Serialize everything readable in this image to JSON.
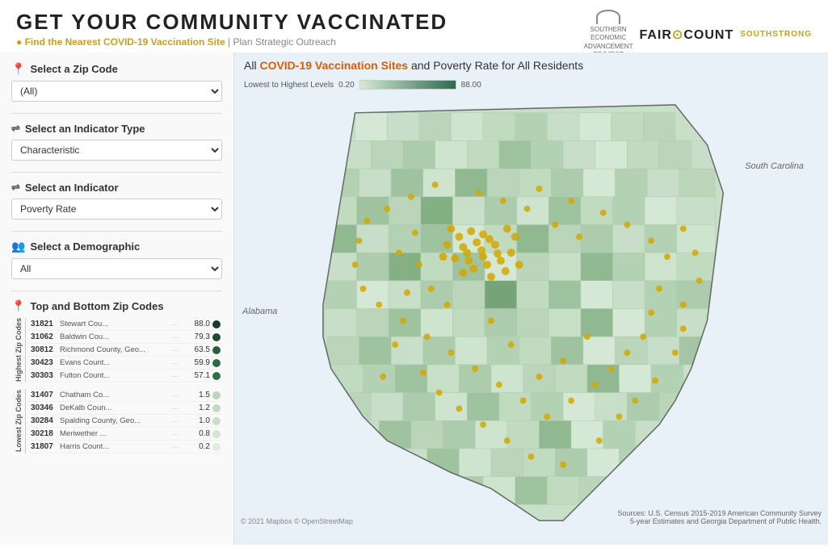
{
  "page": {
    "title": "GET YOUR COMMUNITY VACCINATED",
    "subtitle_link": "Find the Nearest COVID-19 Vaccination Site",
    "subtitle_separator": " | ",
    "subtitle_text": "Plan Strategic Outreach"
  },
  "logos": {
    "seap": "SOUTHERN\nECONOMIC\nADVANCEMENT\nPROJECT",
    "faircount": "FAIR COUNT",
    "southstrong": "SOUTHSTRONG"
  },
  "sidebar": {
    "zip_section": {
      "title": "Select a Zip Code",
      "icon": "location",
      "options": [
        "(All)"
      ],
      "selected": "(All)"
    },
    "indicator_type_section": {
      "title": "Select an Indicator Type",
      "icon": "filter",
      "options": [
        "Characteristic"
      ],
      "selected": "Characteristic"
    },
    "indicator_section": {
      "title": "Select an Indicator",
      "icon": "filter",
      "options": [
        "Poverty Rate"
      ],
      "selected": "Poverty Rate"
    },
    "demographic_section": {
      "title": "Select a Demographic",
      "icon": "people",
      "options": [
        "All"
      ],
      "selected": "All"
    },
    "top_bottom_title": "Top and Bottom Zip Codes",
    "highest_label": "Highest Zip Codes",
    "lowest_label": "Lowest Zip Codes",
    "highest_zips": [
      {
        "code": "31821",
        "county": "Stewart Cou...",
        "value": "88.0",
        "color": "#1a3a2a"
      },
      {
        "code": "31062",
        "county": "Baldwin Cou...",
        "value": "79.3",
        "color": "#1e4a30"
      },
      {
        "code": "30812",
        "county": "Richmond County, Geo...",
        "value": "63.5",
        "color": "#2a5e3a"
      },
      {
        "code": "30423",
        "county": "Evans Count...",
        "value": "59.9",
        "color": "#2f6b40"
      },
      {
        "code": "30303",
        "county": "Fulton Count...",
        "value": "57.1",
        "color": "#336e42"
      }
    ],
    "lowest_zips": [
      {
        "code": "31407",
        "county": "Chatham Co...",
        "value": "1.5",
        "color": "#b8d8b8"
      },
      {
        "code": "30346",
        "county": "DeKalb Coun...",
        "value": "1.2",
        "color": "#c0dcc0"
      },
      {
        "code": "30284",
        "county": "Spalding County, Geo...",
        "value": "1.0",
        "color": "#c8e0c8"
      },
      {
        "code": "30218",
        "county": "Meriwether ...",
        "value": "0.8",
        "color": "#d0e8d0"
      },
      {
        "code": "31807",
        "county": "Harris Count...",
        "value": "0.2",
        "color": "#daf0da"
      }
    ]
  },
  "map": {
    "title_prefix": "All ",
    "title_highlight": "COVID-19 Vaccination Sites",
    "title_suffix": " and Poverty Rate for All Residents",
    "legend_low_label": "Lowest to Highest Levels",
    "legend_min": "0.20",
    "legend_max": "88.00",
    "labels": {
      "south_carolina": "South Carolina",
      "alabama": "Alabama"
    },
    "attribution": "Sources: U.S. Census 2015-2019 American Community Survey 5-year Estimates and Georgia Department of Public Health.",
    "copyright": "© 2021 Mapbox © OpenStreetMap"
  }
}
